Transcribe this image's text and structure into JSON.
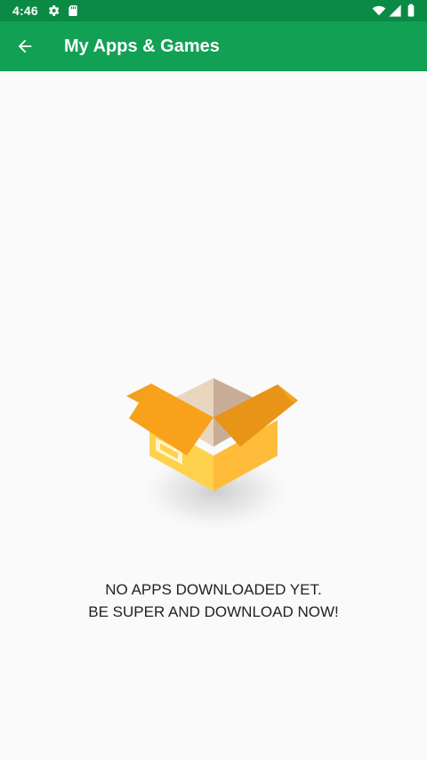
{
  "status_bar": {
    "time": "4:46",
    "icons": [
      "gear-icon",
      "sd-card-icon",
      "wifi-icon",
      "signal-icon",
      "battery-icon"
    ]
  },
  "toolbar": {
    "title": "My Apps & Games",
    "back_icon": "back-arrow-icon"
  },
  "empty_state": {
    "illustration": "open-box-icon",
    "line1": "NO APPS DOWNLOADED YET.",
    "line2": "BE SUPER AND DOWNLOAD NOW!"
  },
  "colors": {
    "status_bar": "#0b8a45",
    "toolbar": "#12a055",
    "background": "#fafafa",
    "box_orange": "#f5a11c",
    "box_yellow": "#ffc845"
  }
}
